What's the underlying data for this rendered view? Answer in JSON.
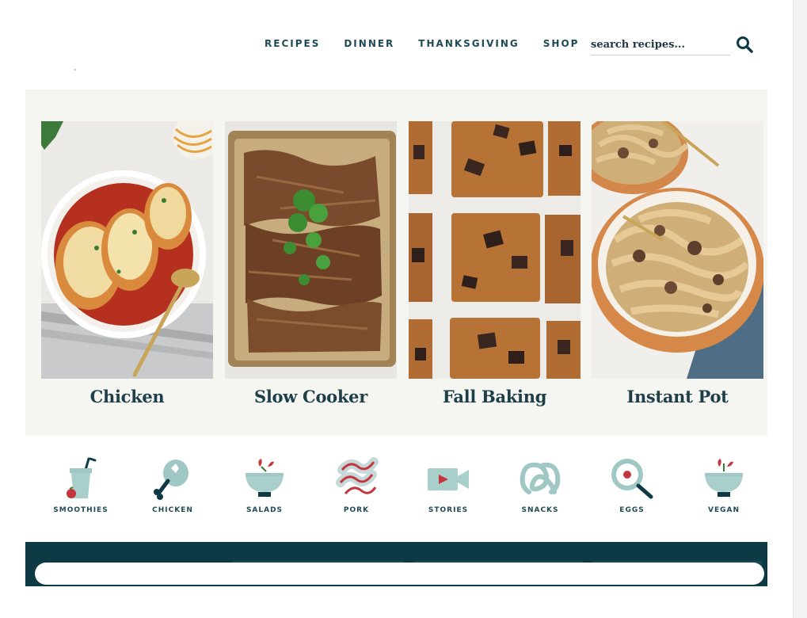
{
  "header": {
    "nav": [
      {
        "label": "RECIPES"
      },
      {
        "label": "DINNER"
      },
      {
        "label": "THANKSGIVING"
      },
      {
        "label": "SHOP"
      }
    ],
    "search": {
      "placeholder": "search recipes...",
      "icon": "search-icon"
    }
  },
  "featured": {
    "cards": [
      {
        "title": "Chicken",
        "image": "chicken-parmesan-photo"
      },
      {
        "title": "Slow Cooker",
        "image": "pulled-pork-sheet-pan-photo"
      },
      {
        "title": "Fall Baking",
        "image": "pumpkin-chocolate-bars-photo"
      },
      {
        "title": "Instant Pot",
        "image": "beef-stroganoff-noodles-photo"
      }
    ]
  },
  "categories": [
    {
      "label": "SMOOTHIES",
      "icon": "smoothie-cup-icon"
    },
    {
      "label": "CHICKEN",
      "icon": "drumstick-icon"
    },
    {
      "label": "SALADS",
      "icon": "salad-bowl-icon"
    },
    {
      "label": "PORK",
      "icon": "bacon-icon"
    },
    {
      "label": "STORIES",
      "icon": "video-camera-icon"
    },
    {
      "label": "SNACKS",
      "icon": "pretzel-icon"
    },
    {
      "label": "EGGS",
      "icon": "frying-pan-egg-icon"
    },
    {
      "label": "VEGAN",
      "icon": "vegan-bowl-icon"
    }
  ],
  "colors": {
    "brand_dark": "#0d3a44",
    "nav_text": "#1e4a55",
    "icon_teal": "#9fc7c4",
    "icon_red": "#c4363f",
    "featured_bg": "#f5f5f2"
  }
}
